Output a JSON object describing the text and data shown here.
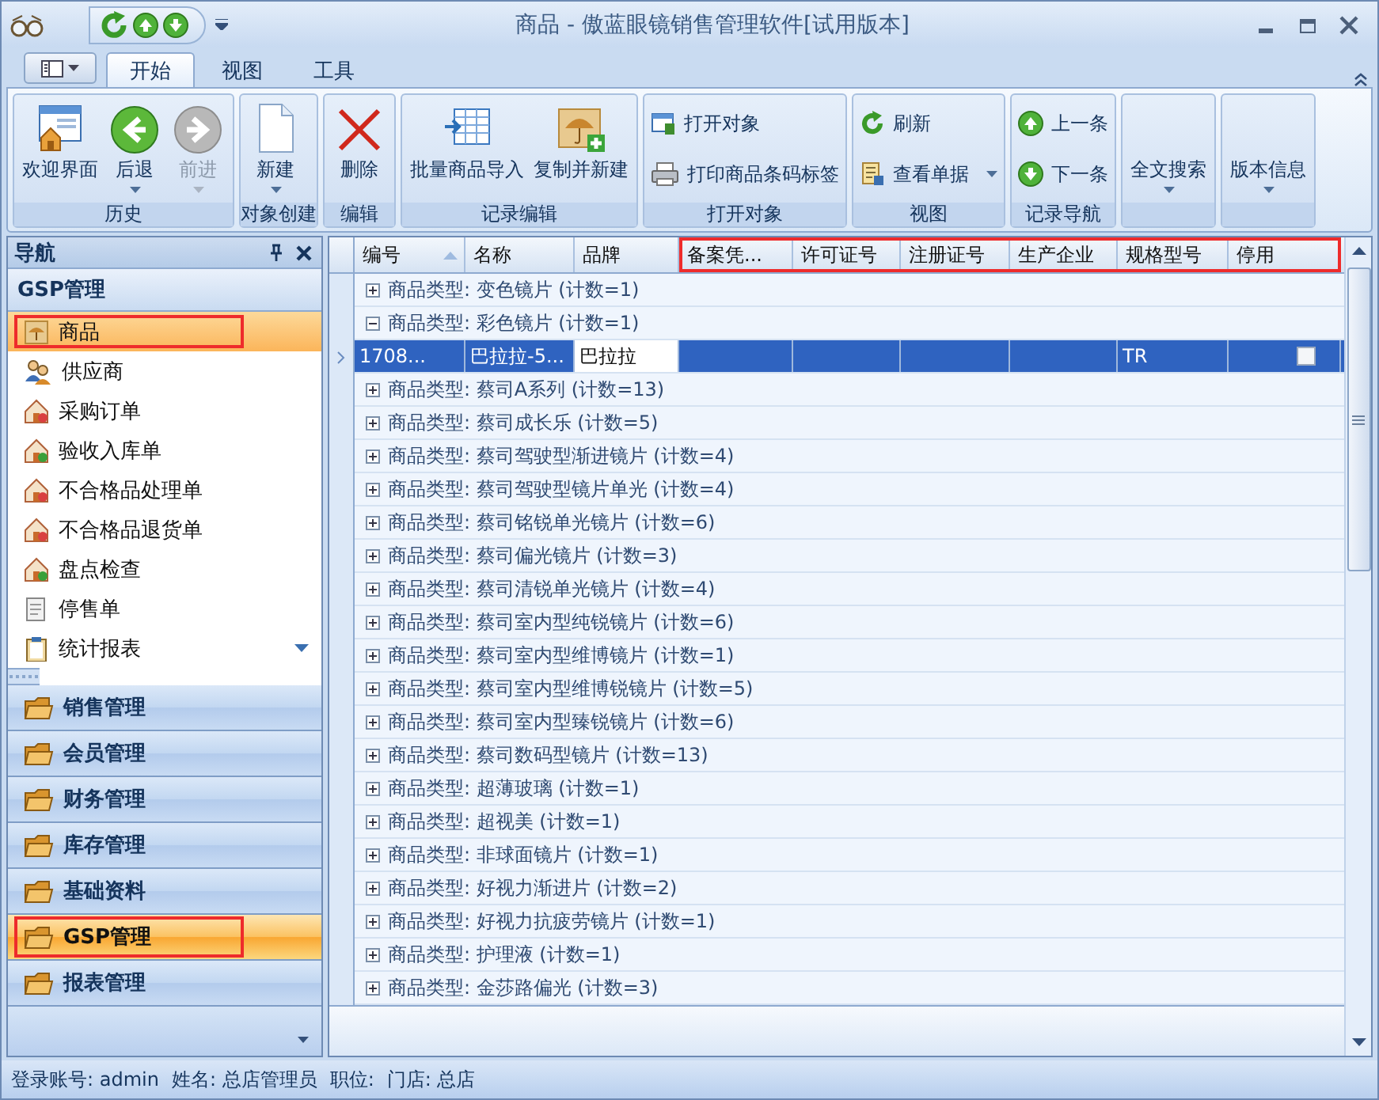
{
  "window": {
    "title": "商品 - 傲蓝眼镜销售管理软件[试用版本]"
  },
  "ribbon_tabs": [
    {
      "label": "开始",
      "selected": true
    },
    {
      "label": "视图",
      "selected": false
    },
    {
      "label": "工具",
      "selected": false
    }
  ],
  "ribbon_groups": [
    {
      "label": "历史",
      "buttons": [
        {
          "kind": "large",
          "label": "欢迎界面",
          "dropdown": false,
          "disabled": false
        },
        {
          "kind": "large",
          "label": "后退",
          "dropdown": true,
          "disabled": false
        },
        {
          "kind": "large",
          "label": "前进",
          "dropdown": true,
          "disabled": true
        }
      ]
    },
    {
      "label": "对象创建",
      "buttons": [
        {
          "kind": "large",
          "label": "新建",
          "dropdown": true,
          "disabled": false
        }
      ]
    },
    {
      "label": "编辑",
      "buttons": [
        {
          "kind": "large",
          "label": "删除",
          "dropdown": false,
          "disabled": false
        }
      ]
    },
    {
      "label": "记录编辑",
      "buttons": [
        {
          "kind": "large",
          "label": "批量商品导入",
          "dropdown": false,
          "disabled": false
        },
        {
          "kind": "large",
          "label": "复制并新建",
          "dropdown": false,
          "disabled": false
        }
      ]
    },
    {
      "label": "打开对象",
      "buttons": [
        {
          "kind": "small",
          "label": "打开对象",
          "dropdown": false,
          "disabled": false
        },
        {
          "kind": "small",
          "label": "打印商品条码标签",
          "dropdown": false,
          "disabled": false
        }
      ]
    },
    {
      "label": "视图",
      "buttons": [
        {
          "kind": "small",
          "label": "刷新",
          "dropdown": false,
          "disabled": false
        },
        {
          "kind": "small",
          "label": "查看单据",
          "dropdown": true,
          "disabled": false
        }
      ]
    },
    {
      "label": "记录导航",
      "buttons": [
        {
          "kind": "small",
          "label": "上一条",
          "dropdown": false,
          "disabled": false
        },
        {
          "kind": "small",
          "label": "下一条",
          "dropdown": false,
          "disabled": false
        }
      ]
    },
    {
      "buttons": [
        {
          "kind": "large",
          "label": "全文搜索",
          "dropdown": true,
          "disabled": false
        }
      ]
    },
    {
      "buttons": [
        {
          "kind": "large",
          "label": "版本信息",
          "dropdown": true,
          "disabled": false
        }
      ]
    }
  ],
  "navigation": {
    "title": "导航",
    "group_title": "GSP管理",
    "items": [
      {
        "label": "商品",
        "selected": true,
        "highlighted": true
      },
      {
        "label": "供应商",
        "selected": false,
        "highlighted": false
      },
      {
        "label": "采购订单",
        "selected": false,
        "highlighted": false
      },
      {
        "label": "验收入库单",
        "selected": false,
        "highlighted": false
      },
      {
        "label": "不合格品处理单",
        "selected": false,
        "highlighted": false
      },
      {
        "label": "不合格品退货单",
        "selected": false,
        "highlighted": false
      },
      {
        "label": "盘点检查",
        "selected": false,
        "highlighted": false
      },
      {
        "label": "停售单",
        "selected": false,
        "highlighted": false
      },
      {
        "label": "统计报表",
        "selected": false,
        "highlighted": false
      }
    ],
    "groups": [
      {
        "label": "销售管理",
        "selected": false,
        "highlighted": false
      },
      {
        "label": "会员管理",
        "selected": false,
        "highlighted": false
      },
      {
        "label": "财务管理",
        "selected": false,
        "highlighted": false
      },
      {
        "label": "库存管理",
        "selected": false,
        "highlighted": false
      },
      {
        "label": "基础资料",
        "selected": false,
        "highlighted": false
      },
      {
        "label": "GSP管理",
        "selected": true,
        "highlighted": true
      },
      {
        "label": "报表管理",
        "selected": false,
        "highlighted": false
      }
    ]
  },
  "table": {
    "columns": [
      {
        "label": "编号",
        "sorted_ascending": true,
        "highlighted": false
      },
      {
        "label": "名称",
        "highlighted": false
      },
      {
        "label": "品牌",
        "highlighted": false
      },
      {
        "label": "备案凭...",
        "highlighted": true
      },
      {
        "label": "许可证号",
        "highlighted": true
      },
      {
        "label": "注册证号",
        "highlighted": true
      },
      {
        "label": "生产企业",
        "highlighted": true
      },
      {
        "label": "规格型号",
        "highlighted": true
      },
      {
        "label": "停用",
        "highlighted": true
      }
    ],
    "rows": [
      {
        "kind": "group",
        "expanded": false,
        "label": "商品类型: 变色镜片 (计数=1)"
      },
      {
        "kind": "group",
        "expanded": true,
        "label": "商品类型: 彩色镜片 (计数=1)"
      },
      {
        "kind": "record",
        "selected": true,
        "cells": [
          {
            "text": "1708..."
          },
          {
            "text": "巴拉拉-5..."
          },
          {
            "text": "巴拉拉",
            "focused": true
          },
          {},
          {},
          {},
          {},
          {
            "text": "TR"
          }
        ],
        "disabled_checked": false
      },
      {
        "kind": "group",
        "expanded": false,
        "label": "商品类型: 蔡司A系列 (计数=13)"
      },
      {
        "kind": "group",
        "expanded": false,
        "label": "商品类型: 蔡司成长乐 (计数=5)"
      },
      {
        "kind": "group",
        "expanded": false,
        "label": "商品类型: 蔡司驾驶型渐进镜片 (计数=4)"
      },
      {
        "kind": "group",
        "expanded": false,
        "label": "商品类型: 蔡司驾驶型镜片单光 (计数=4)"
      },
      {
        "kind": "group",
        "expanded": false,
        "label": "商品类型: 蔡司铭锐单光镜片 (计数=6)"
      },
      {
        "kind": "group",
        "expanded": false,
        "label": "商品类型: 蔡司偏光镜片 (计数=3)"
      },
      {
        "kind": "group",
        "expanded": false,
        "label": "商品类型: 蔡司清锐单光镜片 (计数=4)"
      },
      {
        "kind": "group",
        "expanded": false,
        "label": "商品类型: 蔡司室内型纯锐镜片 (计数=6)"
      },
      {
        "kind": "group",
        "expanded": false,
        "label": "商品类型: 蔡司室内型维博镜片 (计数=1)"
      },
      {
        "kind": "group",
        "expanded": false,
        "label": "商品类型: 蔡司室内型维博锐镜片 (计数=5)"
      },
      {
        "kind": "group",
        "expanded": false,
        "label": "商品类型: 蔡司室内型臻锐镜片 (计数=6)"
      },
      {
        "kind": "group",
        "expanded": false,
        "label": "商品类型: 蔡司数码型镜片 (计数=13)"
      },
      {
        "kind": "group",
        "expanded": false,
        "label": "商品类型: 超薄玻璃 (计数=1)"
      },
      {
        "kind": "group",
        "expanded": false,
        "label": "商品类型: 超视美 (计数=1)"
      },
      {
        "kind": "group",
        "expanded": false,
        "label": "商品类型: 非球面镜片 (计数=1)"
      },
      {
        "kind": "group",
        "expanded": false,
        "label": "商品类型: 好视力渐进片 (计数=2)"
      },
      {
        "kind": "group",
        "expanded": false,
        "label": "商品类型: 好视力抗疲劳镜片 (计数=1)"
      },
      {
        "kind": "group",
        "expanded": false,
        "label": "商品类型: 护理液 (计数=1)"
      },
      {
        "kind": "group",
        "expanded": false,
        "label": "商品类型: 金莎路偏光 (计数=3)"
      }
    ]
  },
  "status_bar": [
    "登录账号: admin",
    "姓名: 总店管理员",
    "职位:",
    "门店: 总店"
  ]
}
